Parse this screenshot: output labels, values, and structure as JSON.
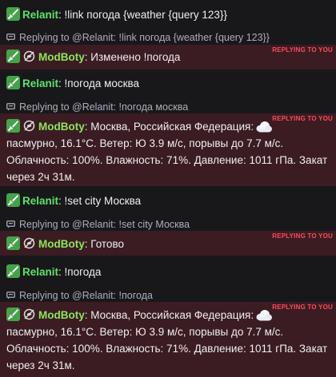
{
  "reply_to_you": "REPLYING TO YOU",
  "messages": [
    {
      "user": "Relanit",
      "colon": ":",
      "text": "!link погода {weather {query 123}}"
    },
    {
      "reply": "Replying to @Relanit: !link погода {weather {query 123}}",
      "user": "ModBoty",
      "colon": ":",
      "text": "Изменено !погода"
    },
    {
      "user": "Relanit",
      "colon": ":",
      "text": "!погода москва"
    },
    {
      "reply": "Replying to @Relanit: !погода москва",
      "user": "ModBoty",
      "colon": ":",
      "text_a": "Москва, Российская Федерация:",
      "text_b": "пасмурно, 16.1°C. Ветер: Ю 3.9 м/с, порывы до 7.7 м/с.",
      "text_c": "Облачность: 100%. Влажность: 71%. Давление: 1011 гПа. Закат",
      "text_d": "через 2ч 31м."
    },
    {
      "user": "Relanit",
      "colon": ":",
      "text": "!set city Москва"
    },
    {
      "reply": "Replying to @Relanit: !set city Москва",
      "user": "ModBoty",
      "colon": ":",
      "text": "Готово"
    },
    {
      "user": "Relanit",
      "colon": ":",
      "text": "!погода"
    },
    {
      "reply": "Replying to @Relanit: !погода",
      "user": "ModBoty",
      "colon": ":",
      "text_a": "Москва, Российская Федерация:",
      "text_b": "пасмурно, 16.1°C. Ветер: Ю 3.9 м/с, порывы до 7.7 м/с.",
      "text_c": "Облачность: 100%. Влажность: 71%. Давление: 1011 гПа. Закат",
      "text_d": "через 2ч 31м."
    }
  ],
  "icons": {
    "badge": "sword-icon",
    "mod": "moderator-shield-icon",
    "weather": "cloud-icon",
    "reply": "reply-icon"
  },
  "colors": {
    "background": "#18181b",
    "highlight": "#3a1c22",
    "relanit": "#5de36b",
    "modboty": "#8ee55a",
    "reply_to_you": "#ff4a5a"
  }
}
